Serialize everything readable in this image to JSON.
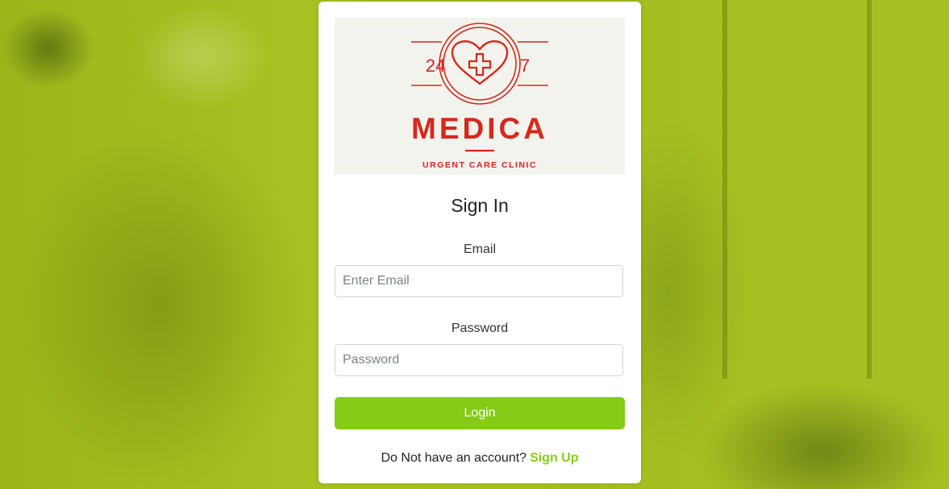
{
  "logo": {
    "left_number": "24",
    "right_number": "7",
    "brand": "MEDICA",
    "tagline": "URGENT CARE CLINIC",
    "color": "#d8281c"
  },
  "form": {
    "title": "Sign In",
    "email_label": "Email",
    "email_placeholder": "Enter Email",
    "password_label": "Password",
    "password_placeholder": "Password",
    "login_label": "Login",
    "signup_prompt": "Do Not have an account?",
    "signup_link": "Sign Up"
  },
  "colors": {
    "accent": "#84cc16",
    "background_tint": "#a4bf22"
  }
}
